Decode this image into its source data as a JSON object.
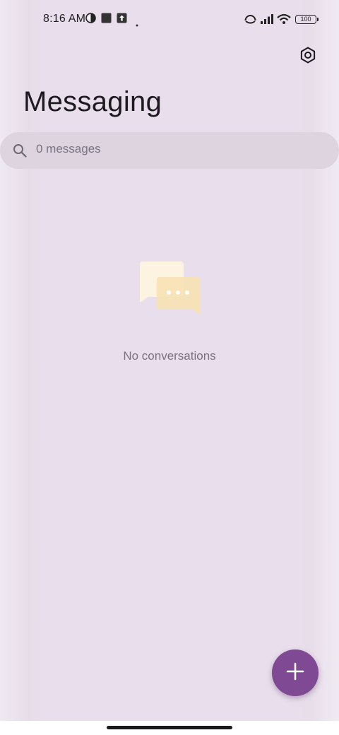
{
  "status_bar": {
    "time": "8:16 AM",
    "battery": "100",
    "icons": [
      "vpn-key-icon",
      "stop-square-icon",
      "upload-arrow-icon",
      "dot-icon",
      "hotspot-icon",
      "signal-icon",
      "wifi-icon",
      "battery-icon"
    ]
  },
  "header": {
    "title": "Messaging",
    "settings_icon": "settings-hexagon-icon"
  },
  "search": {
    "placeholder": "0 messages",
    "icon": "search-icon"
  },
  "empty_state": {
    "text": "No conversations",
    "icon": "chat-bubbles-icon"
  },
  "fab": {
    "icon": "plus-icon",
    "color": "#7f4a93"
  },
  "colors": {
    "background": "#e9e0ec",
    "search_background": "#ddd4e0",
    "accent": "#7f4a93"
  }
}
